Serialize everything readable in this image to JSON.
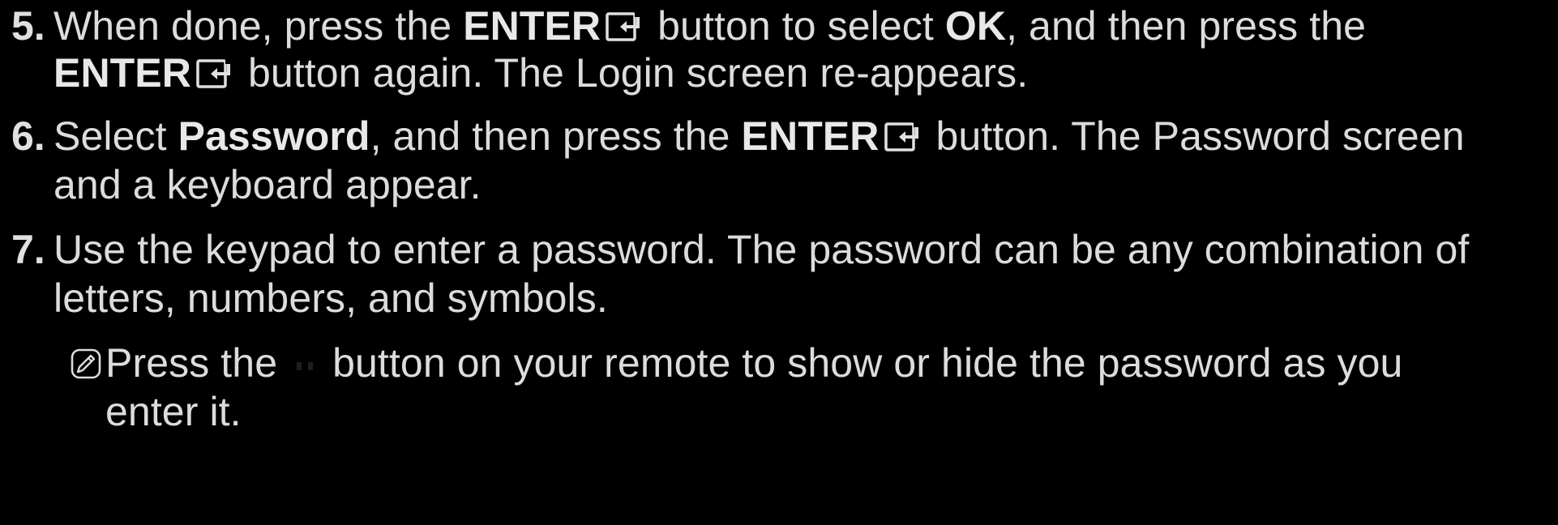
{
  "steps": [
    {
      "number": "5.",
      "line1": {
        "t1": "When done, press the ",
        "b1": "ENTER",
        "t2": " button to select ",
        "b2": "OK",
        "t3": ", and then press the"
      },
      "line2": {
        "b1": "ENTER",
        "t1": " button again. The Login screen re-appears."
      }
    },
    {
      "number": "6.",
      "line1": {
        "t1": "Select ",
        "b1": "Password",
        "t2": ", and then press the ",
        "b2": "ENTER",
        "t3": " button. The Password screen"
      },
      "line2": {
        "t1": "and a keyboard appear."
      }
    },
    {
      "number": "7.",
      "line1": {
        "t1": "Use the keypad to enter a password. The password can be any combination of"
      },
      "line2": {
        "t1": "letters, numbers, and symbols."
      }
    }
  ],
  "note": {
    "icon": "note-icon",
    "line1_a": "Press the",
    "line1_b": "button on your remote to show or hide the password as you",
    "line2": "enter it."
  },
  "icons": {
    "enter": "enter-icon",
    "remote_button": "remote-button-icon"
  },
  "colors": {
    "background": "#000000",
    "text": "#dcdcdc"
  }
}
